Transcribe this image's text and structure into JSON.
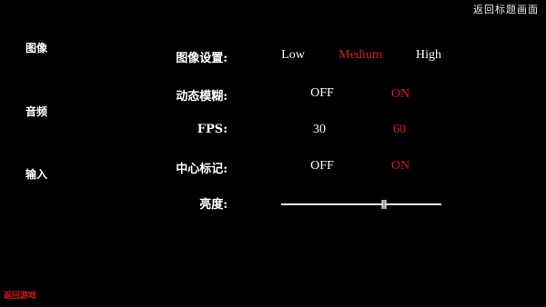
{
  "header": {
    "return_title": "返回标题画面"
  },
  "sidebar": {
    "items": [
      {
        "label": "图像"
      },
      {
        "label": "音频"
      },
      {
        "label": "输入"
      }
    ]
  },
  "settings": {
    "image_quality": {
      "label": "图像设置:",
      "options": [
        "Low",
        "Medium",
        "High"
      ],
      "selected": "Medium"
    },
    "motion_blur": {
      "label": "动态模糊:",
      "options": [
        "OFF",
        "ON"
      ],
      "selected": "ON"
    },
    "fps": {
      "label": "FPS:",
      "options": [
        "30",
        "60"
      ],
      "selected": "60"
    },
    "crosshair": {
      "label": "中心标记:",
      "options": [
        "OFF",
        "ON"
      ],
      "selected": "ON"
    },
    "brightness": {
      "label": "亮度:",
      "value": 0.64
    }
  },
  "footer": {
    "return_game": "返回游戏"
  },
  "colors": {
    "background": "#000000",
    "text": "#ffffff",
    "selected": "#d11c1c"
  }
}
